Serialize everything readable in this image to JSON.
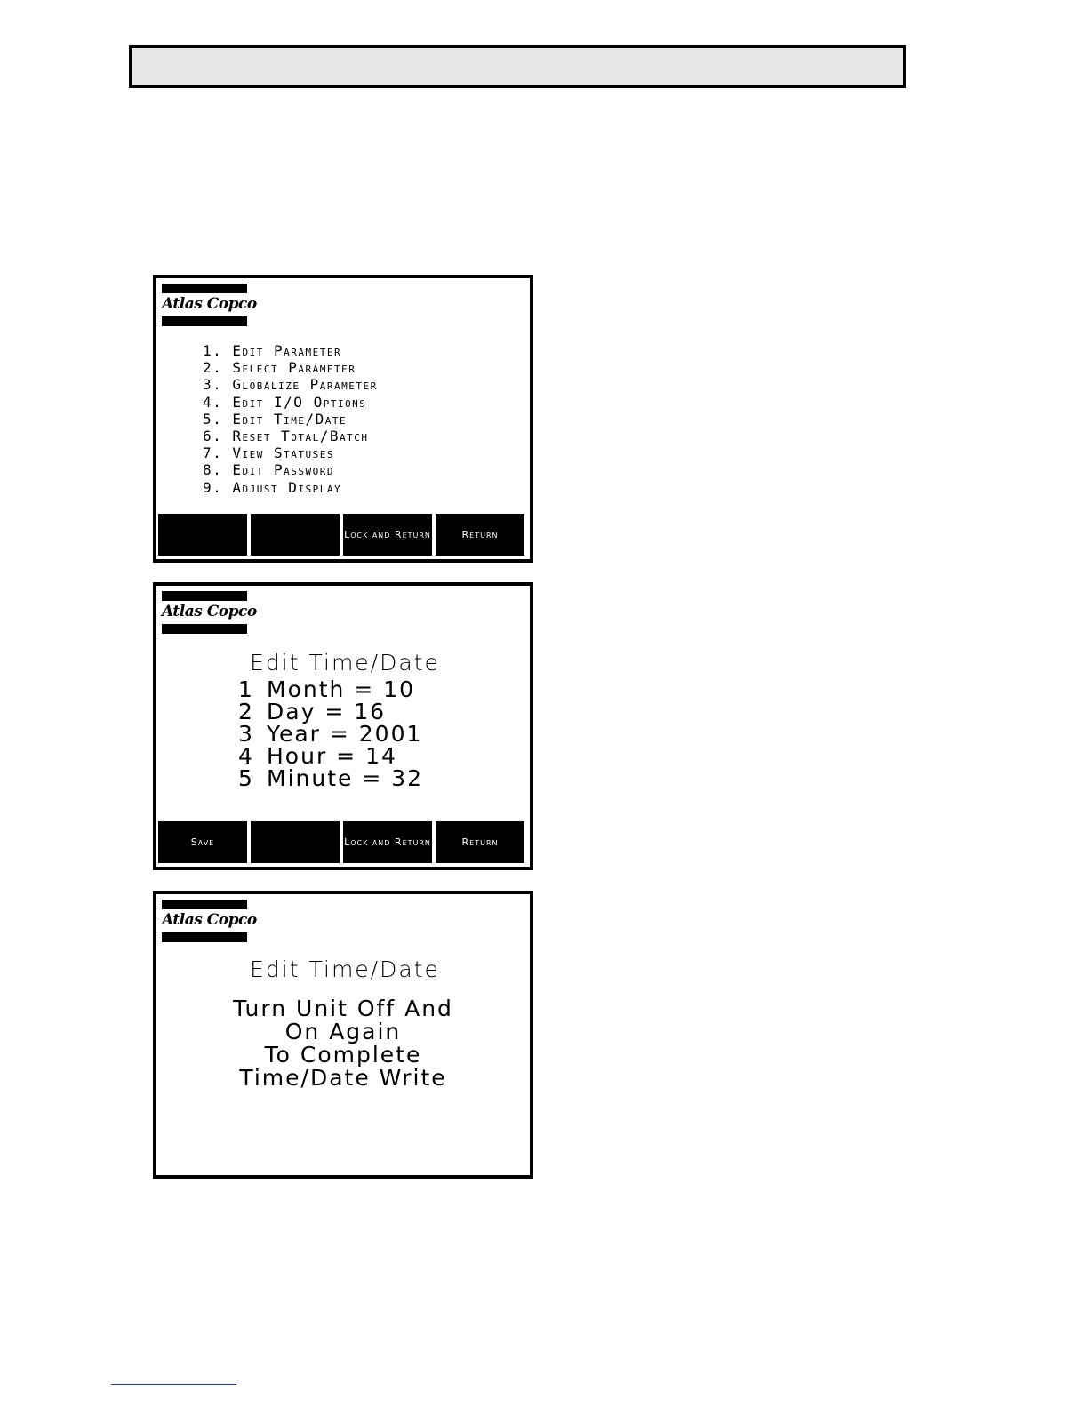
{
  "brand": "Atlas Copco",
  "screens": {
    "menu": {
      "items": [
        "1. Edit Parameter",
        "2. Select Parameter",
        "3. Globalize Parameter",
        "4. Edit I/O Options",
        "5. Edit Time/Date",
        "6. Reset Total/Batch",
        "7. View Statuses",
        "8. Edit Password",
        "9. Adjust Display"
      ],
      "softkeys": [
        "",
        "",
        "Lock and Return",
        "Return"
      ]
    },
    "edit": {
      "title": "Edit Time/Date",
      "fields": [
        {
          "num": "1",
          "label": "Month",
          "value": "10"
        },
        {
          "num": "2",
          "label": "Day",
          "value": "16"
        },
        {
          "num": "3",
          "label": "Year",
          "value": "2001"
        },
        {
          "num": "4",
          "label": "Hour",
          "value": "14"
        },
        {
          "num": "5",
          "label": "Minute",
          "value": "32"
        }
      ],
      "softkeys": [
        "Save",
        "",
        "Lock and Return",
        "Return"
      ]
    },
    "notice": {
      "title": "Edit Time/Date",
      "lines": [
        "Turn Unit Off And",
        "On Again",
        "To Complete",
        "Time/Date Write"
      ]
    }
  }
}
